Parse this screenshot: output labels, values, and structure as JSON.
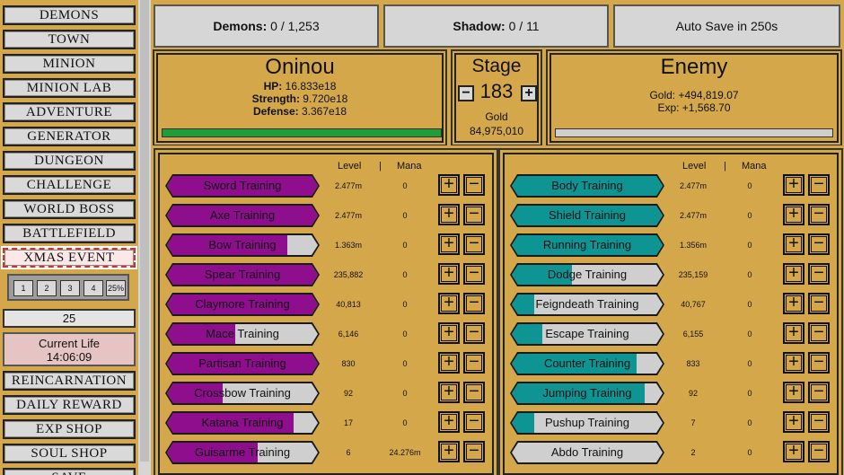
{
  "sidebar": {
    "nav": [
      {
        "id": "demons",
        "label": "DEMONS"
      },
      {
        "id": "town",
        "label": "TOWN"
      },
      {
        "id": "minion",
        "label": "MINION"
      },
      {
        "id": "minion-lab",
        "label": "MINION LAB"
      },
      {
        "id": "adventure",
        "label": "ADVENTURE"
      },
      {
        "id": "generator",
        "label": "GENERATOR"
      },
      {
        "id": "dungeon",
        "label": "DUNGEON"
      },
      {
        "id": "challenge",
        "label": "CHALLENGE"
      },
      {
        "id": "world-boss",
        "label": "WORLD BOSS"
      },
      {
        "id": "battlefield",
        "label": "BATTLEFIELD"
      },
      {
        "id": "xmas-event",
        "label": "XMAS EVENT"
      }
    ],
    "speed_buttons": [
      "1",
      "2",
      "3",
      "4",
      "25%"
    ],
    "speed_value": "25",
    "current_life_label": "Current Life",
    "current_life_time": "14:06:09",
    "nav_bottom": [
      {
        "id": "reincarnation",
        "label": "REINCARNATION"
      },
      {
        "id": "daily-reward",
        "label": "DAILY REWARD"
      },
      {
        "id": "exp-shop",
        "label": "EXP SHOP"
      },
      {
        "id": "soul-shop",
        "label": "SOUL SHOP"
      },
      {
        "id": "save",
        "label": "SAVE"
      }
    ]
  },
  "top": {
    "demons_label": "Demons:",
    "demons_value": "0 / 1,253",
    "shadow_label": "Shadow:",
    "shadow_value": "0 / 11",
    "autosave": "Auto Save in 250s"
  },
  "player": {
    "name": "Oninou",
    "hp_label": "HP:",
    "hp": "16.833e18",
    "strength_label": "Strength:",
    "strength": "9.720e18",
    "defense_label": "Defense:",
    "defense": "3.367e18",
    "hp_fraction": 1.0
  },
  "stage": {
    "title": "Stage",
    "value": "183",
    "minus": "−",
    "plus": "+",
    "gold_label": "Gold",
    "gold_value": "84,975,010"
  },
  "enemy": {
    "title": "Enemy",
    "gold": "Gold: +494,819.07",
    "exp": "Exp: +1,568.70",
    "hp_fraction": 0.0
  },
  "columns": {
    "level": "Level",
    "sep": "|",
    "mana": "Mana"
  },
  "colors": {
    "attack_fill": "#8e0e8e",
    "defense_fill": "#0f9494",
    "gold_bg": "#d4a84a"
  },
  "attack_training": [
    {
      "label": "Sword Training",
      "level": "2.477m",
      "mana": "0",
      "progress": 1.0
    },
    {
      "label": "Axe Training",
      "level": "2.477m",
      "mana": "0",
      "progress": 1.0
    },
    {
      "label": "Bow Training",
      "level": "1.363m",
      "mana": "0",
      "progress": 0.8
    },
    {
      "label": "Spear Training",
      "level": "235,882",
      "mana": "0",
      "progress": 1.0
    },
    {
      "label": "Claymore Training",
      "level": "40,813",
      "mana": "0",
      "progress": 1.0
    },
    {
      "label": "Mace Training",
      "level": "6,146",
      "mana": "0",
      "progress": 0.45
    },
    {
      "label": "Partisan Training",
      "level": "830",
      "mana": "0",
      "progress": 1.0
    },
    {
      "label": "Crossbow Training",
      "level": "92",
      "mana": "0",
      "progress": 0.37
    },
    {
      "label": "Katana Training",
      "level": "17",
      "mana": "0",
      "progress": 0.84
    },
    {
      "label": "Guisarme Training",
      "level": "6",
      "mana": "24.276m",
      "progress": 0.6
    }
  ],
  "defense_training": [
    {
      "label": "Body Training",
      "level": "2.477m",
      "mana": "0",
      "progress": 1.0
    },
    {
      "label": "Shield Training",
      "level": "2.477m",
      "mana": "0",
      "progress": 1.0
    },
    {
      "label": "Running Training",
      "level": "1.356m",
      "mana": "0",
      "progress": 1.0
    },
    {
      "label": "Dodge Training",
      "level": "235,159",
      "mana": "0",
      "progress": 0.4
    },
    {
      "label": "Feigndeath Training",
      "level": "40,767",
      "mana": "0",
      "progress": 0.15
    },
    {
      "label": "Escape Training",
      "level": "6,155",
      "mana": "0",
      "progress": 0.2
    },
    {
      "label": "Counter Training",
      "level": "833",
      "mana": "0",
      "progress": 0.83
    },
    {
      "label": "Jumping Training",
      "level": "92",
      "mana": "0",
      "progress": 0.88
    },
    {
      "label": "Pushup Training",
      "level": "7",
      "mana": "0",
      "progress": 0.15
    },
    {
      "label": "Abdo Training",
      "level": "2",
      "mana": "0",
      "progress": 0.0
    }
  ],
  "pm": {
    "plus": "+",
    "minus": "−"
  }
}
